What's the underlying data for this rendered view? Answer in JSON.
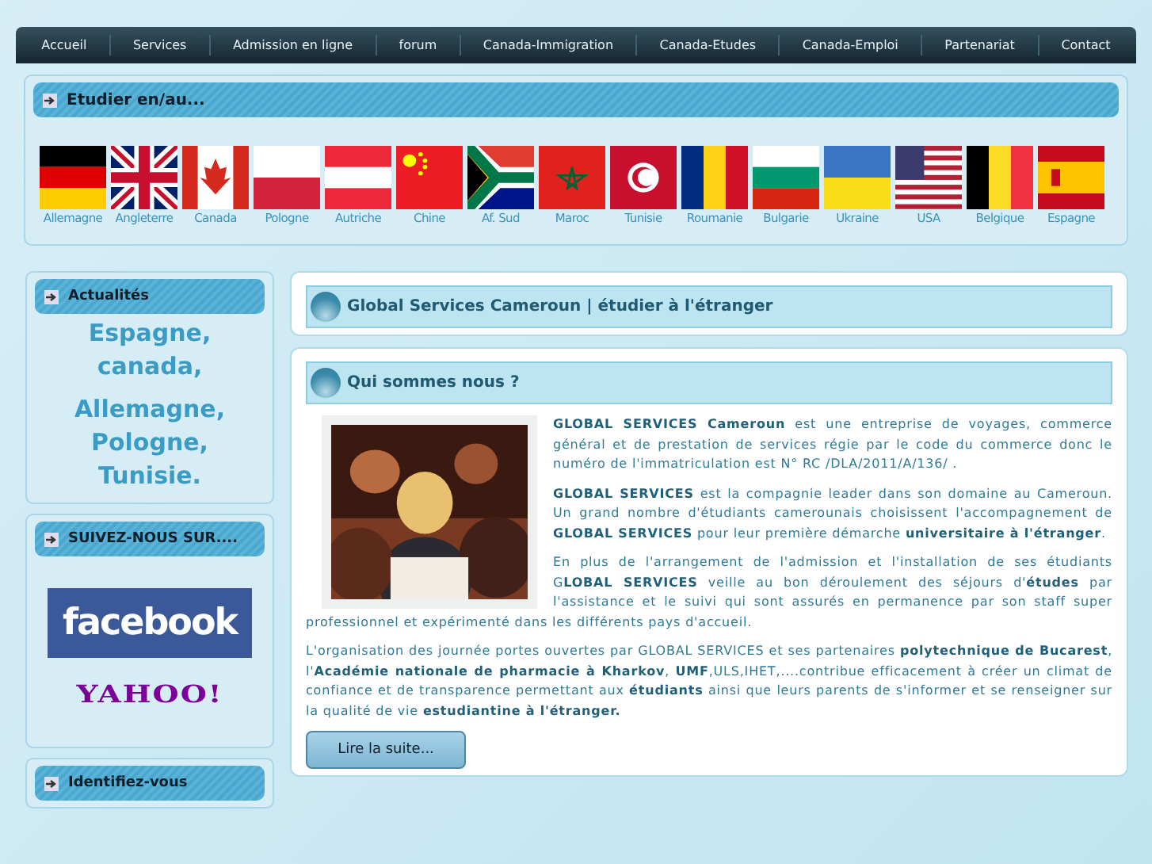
{
  "nav": [
    "Accueil",
    "Services",
    "Admission en ligne",
    "forum",
    "Canada-Immigration",
    "Canada-Etudes",
    "Canada-Emploi",
    "Partenariat",
    "Contact"
  ],
  "study": {
    "title": "Etudier en/au...",
    "countries": [
      {
        "label": "Allemagne",
        "kind": "de"
      },
      {
        "label": "Angleterre",
        "kind": "gb"
      },
      {
        "label": "Canada",
        "kind": "ca"
      },
      {
        "label": "Pologne",
        "kind": "pl"
      },
      {
        "label": "Autriche",
        "kind": "at"
      },
      {
        "label": "Chine",
        "kind": "cn"
      },
      {
        "label": "Af. Sud",
        "kind": "za"
      },
      {
        "label": "Maroc",
        "kind": "ma"
      },
      {
        "label": "Tunisie",
        "kind": "tn"
      },
      {
        "label": "Roumanie",
        "kind": "ro"
      },
      {
        "label": "Bulgarie",
        "kind": "bg"
      },
      {
        "label": "Ukraine",
        "kind": "ua"
      },
      {
        "label": "USA",
        "kind": "us"
      },
      {
        "label": "Belgique",
        "kind": "be"
      },
      {
        "label": "Espagne",
        "kind": "es"
      }
    ]
  },
  "news": {
    "title": "Actualités",
    "items": [
      "Espagne,",
      "canada,",
      "Allemagne,",
      "Pologne,",
      "Tunisie."
    ]
  },
  "follow": {
    "title": "SUIVEZ-NOUS SUR....",
    "facebook": "facebook",
    "yahoo": "YAHOO!"
  },
  "login": {
    "title": "Identifiez-vous"
  },
  "page_title": "Global Services Cameroun | étudier à l'étranger",
  "about": {
    "title": "Qui sommes nous ?",
    "paragraphs": [
      "**GLOBAL SERVICES Cameroun** est une entreprise de voyages, commerce général et de prestation de services régie par le code du commerce donc le numéro de l'immatriculation est N° RC /DLA/2011/A/136/ .",
      "**GLOBAL SERVICES** est la compagnie leader dans son domaine au Cameroun. Un grand nombre d'étudiants camerounais choisissent l'accompagnement de **GLOBAL SERVICES** pour leur première démarche **universitaire à l'étranger**.",
      "En plus de l'arrangement de l'admission et l'installation de ses étudiants G**LOBAL SERVICES** veille au bon déroulement des séjours d'**études** par l'assistance et le suivi qui  sont assurés en permanence par son staff super professionnel et expérimenté dans les différents pays d'accueil.",
      "L'organisation des journée portes ouvertes par GLOBAL SERVICES  et ses partenaires **polytechnique de Bucarest**, l'**Académie nationale de pharmacie à Kharkov**, **UMF**,ULS,IHET,....contribue efficacement à créer un climat de confiance et de transparence permettant aux **étudiants** ainsi que leurs parents de s'informer et se renseigner sur la qualité de vie **estudiantine à l'étranger.**"
    ],
    "more": "Lire la suite..."
  }
}
